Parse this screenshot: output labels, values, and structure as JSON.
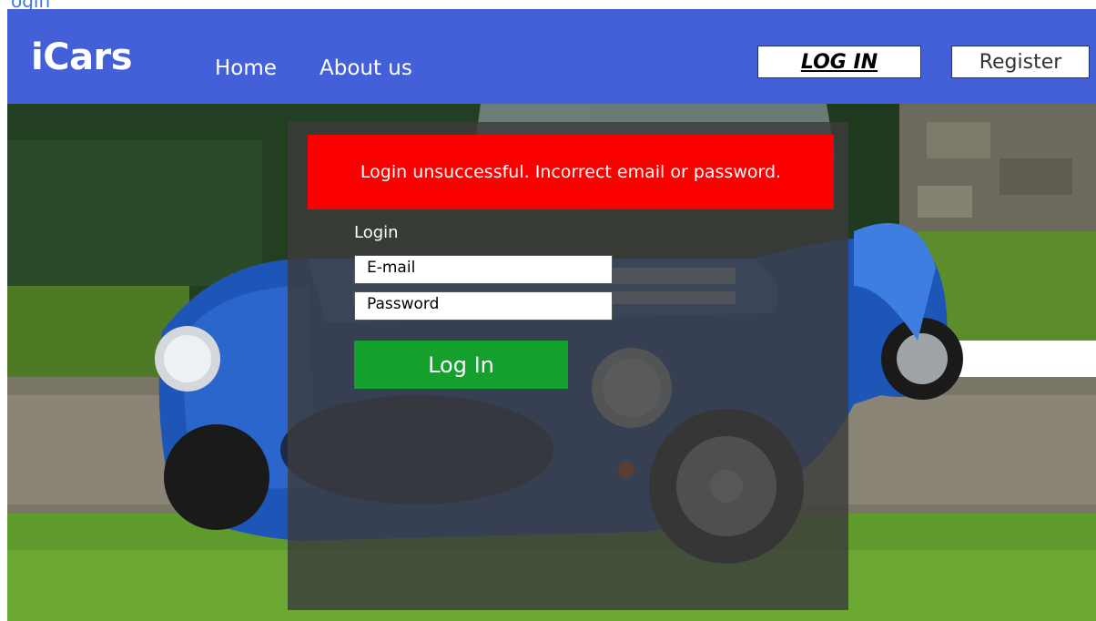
{
  "page": {
    "top_clip_text": "ogin"
  },
  "navbar": {
    "brand": "iCars",
    "links": [
      "Home",
      "About us"
    ],
    "login_label": "LOG IN",
    "register_label": "Register",
    "bg_color": "#4460d8"
  },
  "hero": {
    "image": "blue-sports-car-photo"
  },
  "login_form": {
    "error_message": "Login unsuccessful. Incorrect email or password.",
    "title": "Login",
    "email_placeholder": "E-mail",
    "password_placeholder": "Password",
    "submit_label": "Log In",
    "error_color": "#fa0000",
    "submit_color": "#15a02e"
  }
}
